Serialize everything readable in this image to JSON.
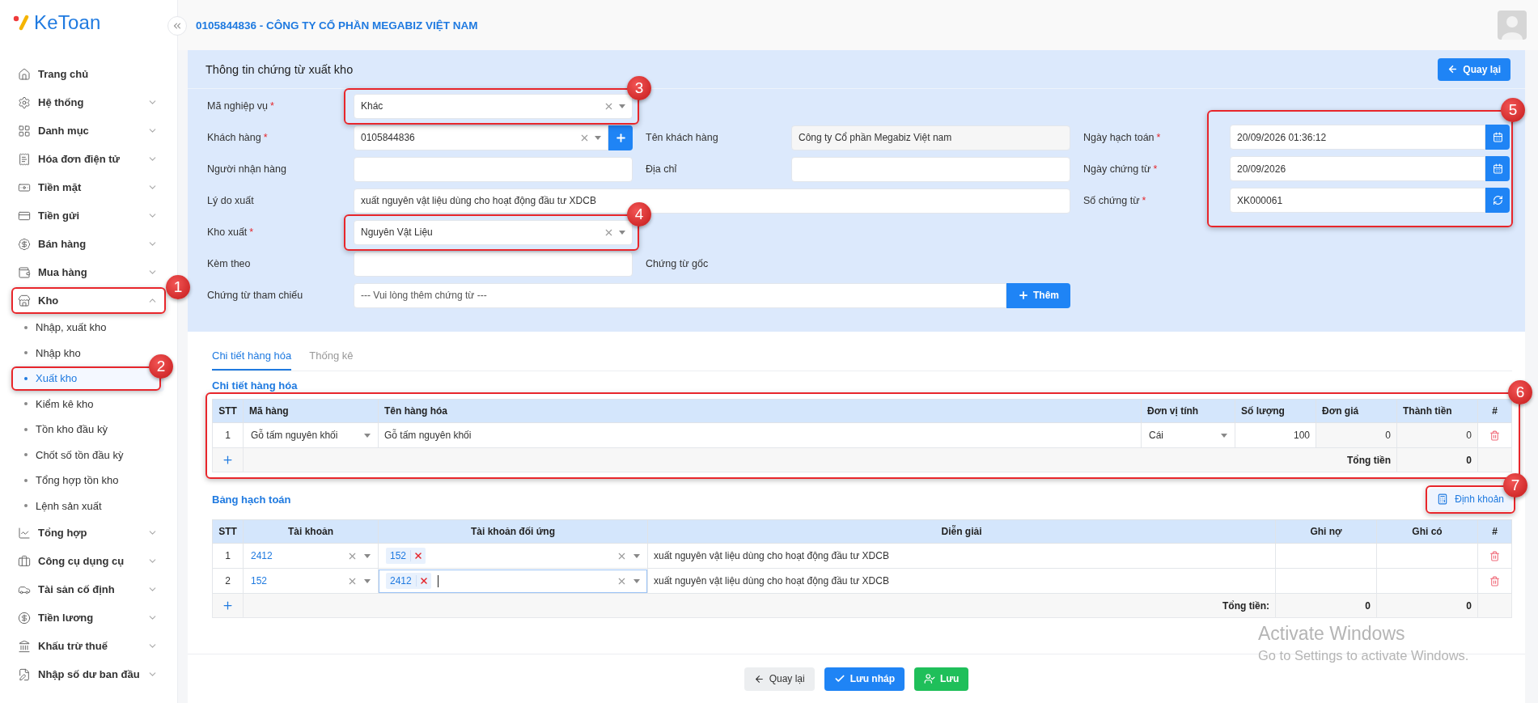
{
  "brand": {
    "name": "KeToan"
  },
  "sidebar": {
    "items": [
      {
        "label": "Trang chủ",
        "kind": "link"
      },
      {
        "label": "Hệ thống",
        "kind": "group",
        "expanded": false
      },
      {
        "label": "Danh mục",
        "kind": "group",
        "expanded": false
      },
      {
        "label": "Hóa đơn điện tử",
        "kind": "group",
        "expanded": false
      },
      {
        "label": "Tiền mặt",
        "kind": "group",
        "expanded": false
      },
      {
        "label": "Tiền gửi",
        "kind": "group",
        "expanded": false
      },
      {
        "label": "Bán hàng",
        "kind": "group",
        "expanded": false
      },
      {
        "label": "Mua hàng",
        "kind": "group",
        "expanded": false
      },
      {
        "label": "Kho",
        "kind": "group",
        "expanded": true,
        "callout": "1",
        "children": [
          {
            "label": "Nhập, xuất kho",
            "selected": false
          },
          {
            "label": "Nhập kho",
            "selected": false
          },
          {
            "label": "Xuất kho",
            "selected": true,
            "callout": "2"
          },
          {
            "label": "Kiểm kê kho",
            "selected": false
          },
          {
            "label": "Tồn kho đầu kỳ",
            "selected": false
          },
          {
            "label": "Chốt số tồn đầu kỳ",
            "selected": false
          },
          {
            "label": "Tổng hợp tồn kho",
            "selected": false
          },
          {
            "label": "Lệnh sản xuất",
            "selected": false
          }
        ]
      },
      {
        "label": "Tổng hợp",
        "kind": "group",
        "expanded": false
      },
      {
        "label": "Công cụ dụng cụ",
        "kind": "group",
        "expanded": false
      },
      {
        "label": "Tài sản cố định",
        "kind": "group",
        "expanded": false
      },
      {
        "label": "Tiền lương",
        "kind": "group",
        "expanded": false
      },
      {
        "label": "Khấu trừ thuế",
        "kind": "group",
        "expanded": false
      },
      {
        "label": "Nhập số dư ban đầu",
        "kind": "group",
        "expanded": false
      }
    ]
  },
  "header": {
    "company": "0105844836 - CÔNG TY CỔ PHẦN MEGABIZ VIỆT NAM"
  },
  "panel": {
    "title": "Thông tin chứng từ xuất kho",
    "back_button": "Quay lại",
    "rows": [
      [
        {
          "label": "Mã nghiệp vụ",
          "mark": "*",
          "kind": "select",
          "value": "Khác",
          "callout": "3"
        }
      ],
      [
        {
          "label": "Khách hàng",
          "mark": "*",
          "kind": "select_add",
          "value": "0105844836"
        },
        {
          "label": "Tên khách hàng",
          "kind": "readonly",
          "value": "Công ty Cổ phần Megabiz Việt nam"
        }
      ],
      [
        {
          "label": "Người nhận hàng",
          "kind": "text"
        },
        {
          "label": "Địa chỉ",
          "kind": "text"
        }
      ],
      [
        {
          "label": "Lý do xuất",
          "kind": "long_text",
          "value": "xuất nguyên vật liệu dùng cho hoạt động đầu tư XDCB"
        }
      ],
      [
        {
          "label": "Kho xuất",
          "mark": "*",
          "kind": "select",
          "value": "Nguyên Vật Liệu",
          "callout": "4"
        }
      ],
      [
        {
          "label": "Kèm theo",
          "kind": "text"
        },
        {
          "label": "Chứng từ gốc",
          "kind": "label_only"
        }
      ],
      [
        {
          "label": "Chứng từ tham chiếu",
          "kind": "picker",
          "placeholder": "--- Vui lòng thêm chứng từ ---",
          "button": "Thêm"
        }
      ]
    ],
    "right_callout": "5",
    "right_fields": [
      {
        "label": "Ngày hạch toán",
        "mark": "*",
        "kind": "date",
        "value": "20/09/2026 01:36:12"
      },
      {
        "label": "Ngày chứng từ",
        "mark": "*",
        "kind": "date",
        "value": "20/09/2026"
      },
      {
        "label": "Số chứng từ",
        "mark": "*",
        "kind": "code",
        "value": "XK000061"
      }
    ]
  },
  "tabs": [
    {
      "label": "Chi tiết hàng hóa",
      "selected": true
    },
    {
      "label": "Thống kê",
      "selected": false
    }
  ],
  "goods": {
    "title": "Chi tiết hàng hóa",
    "callout": "6",
    "columns": [
      "STT",
      "Mã hàng",
      "Tên hàng hóa",
      "Đơn vị tính",
      "Số lượng",
      "Đơn giá",
      "Thành tiền",
      "#"
    ],
    "rows": [
      {
        "stt": "1",
        "code": "Gỗ tấm nguyên khối",
        "name": "Gỗ tấm nguyên khối",
        "unit": "Cái",
        "quantity": "100",
        "price": "0",
        "amount": "0"
      }
    ],
    "total_label": "Tổng tiền",
    "total": "0"
  },
  "ledger": {
    "title": "Bảng hạch toán",
    "button": "Định khoản",
    "button_callout": "7",
    "columns": [
      "STT",
      "Tài khoản",
      "Tài khoản đối ứng",
      "Diễn giải",
      "Ghi nợ",
      "Ghi có",
      "#"
    ],
    "rows": [
      {
        "stt": "1",
        "account": "2412",
        "contra": [
          "152"
        ],
        "focused": false,
        "note": "xuất nguyên vật liệu dùng cho hoạt động đầu tư XDCB"
      },
      {
        "stt": "2",
        "account": "152",
        "contra": [
          "2412"
        ],
        "focused": true,
        "note": "xuất nguyên vật liệu dùng cho hoạt động đầu tư XDCB"
      }
    ],
    "total_label": "Tổng tiền:",
    "debit_total": "0",
    "credit_total": "0"
  },
  "footer_buttons": [
    {
      "label": "Quay lại",
      "kind": "back"
    },
    {
      "label": "Lưu nháp",
      "kind": "draft"
    },
    {
      "label": "Lưu",
      "kind": "save"
    }
  ],
  "os_notice": {
    "title": "Activate Windows",
    "text": "Go to Settings to activate Windows."
  }
}
